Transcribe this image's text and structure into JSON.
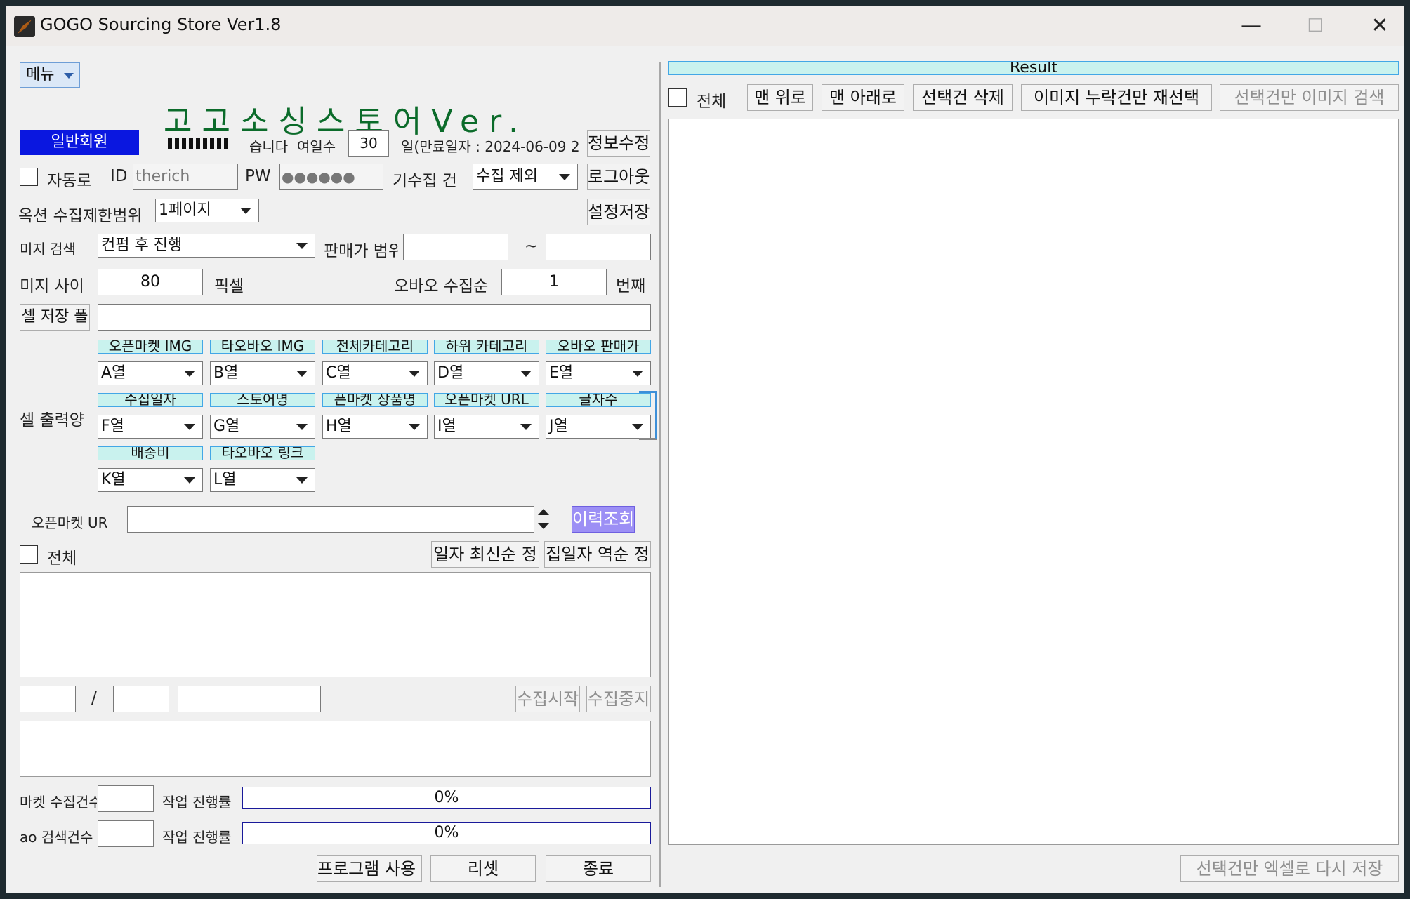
{
  "window": {
    "title": "GOGO Sourcing Store Ver1.8",
    "minimize": "—",
    "maximize": "☐",
    "close": "✕"
  },
  "menu": {
    "label": "메뉴"
  },
  "brand": {
    "text": "고고소싱스토어Ver."
  },
  "member": {
    "badge": "일반회원",
    "greeting": "습니다",
    "days_label": "여일수",
    "days_value": "30",
    "expiry": "일(만료일자 : 2024-06-09 2",
    "edit_button": "정보수정"
  },
  "login": {
    "auto_label": "자동로",
    "id_label": "ID",
    "id_value": "therich",
    "pw_label": "PW",
    "pw_value": "●●●●●●",
    "collected_label": "기수집 건",
    "collected_option": "수집 제외",
    "logout_button": "로그아웃"
  },
  "auction": {
    "label": "옥션 수집제한범위",
    "option": "1페이지",
    "save_button": "설정저장"
  },
  "image_search": {
    "label": "미지 검색",
    "option": "컨펌 후 진행",
    "price_label": "판매가 범위",
    "price_min": "",
    "tilde": "~",
    "price_max": ""
  },
  "image_size": {
    "label": "미지 사이",
    "value": "80",
    "unit": "픽셀",
    "taobao_label": "오바오 수집순",
    "taobao_value": "1",
    "taobao_unit": "번째"
  },
  "excel_folder": {
    "button": "셀 저장 폴",
    "value": ""
  },
  "excel_output": {
    "label": "셀 출력양",
    "row1_headers": [
      "오픈마켓 IMG",
      "타오바오 IMG",
      "전체카테고리",
      "하위 카테고리",
      "오바오 판매가"
    ],
    "row1_values": [
      "A열",
      "B열",
      "C열",
      "D열",
      "E열"
    ],
    "row2_headers": [
      "수집일자",
      "스토어명",
      "픈마켓 상품명",
      "오픈마켓 URL",
      "글자수"
    ],
    "row2_values": [
      "F열",
      "G열",
      "H열",
      "I열",
      "J열"
    ],
    "row3_headers": [
      "배송비",
      "타오바오 링크"
    ],
    "row3_values": [
      "K열",
      "L열"
    ]
  },
  "openmarket": {
    "label": "오픈마켓 UR",
    "value": "",
    "history_button": "이력조회"
  },
  "list": {
    "all_label": "전체",
    "newest_button": "일자 최신순 정",
    "oldest_button": "집일자 역순 정"
  },
  "progress": {
    "current": "",
    "slash": "/",
    "total": "",
    "status": "",
    "start_button": "수집시작",
    "stop_button": "수집중지"
  },
  "stats": {
    "market_label": "마켓 수집건수",
    "market_value": "",
    "work1_label": "작업 진행률",
    "work1_value": "0%",
    "taobao_label": "ao 검색건수",
    "taobao_value": "",
    "work2_label": "작업 진행률",
    "work2_value": "0%"
  },
  "footer": {
    "manual_button": "프로그램 사용 매뉴",
    "reset_button": "리셋",
    "exit_button": "종료"
  },
  "result": {
    "header": "Result",
    "all_label": "전체",
    "top_button": "맨 위로",
    "bottom_button": "맨 아래로",
    "delete_button": "선택건 삭제",
    "reselect_button": "이미지 누락건만 재선택",
    "search_button": "선택건만 이미지 검색",
    "excel_button": "선택건만 엑셀로 다시 저장"
  }
}
